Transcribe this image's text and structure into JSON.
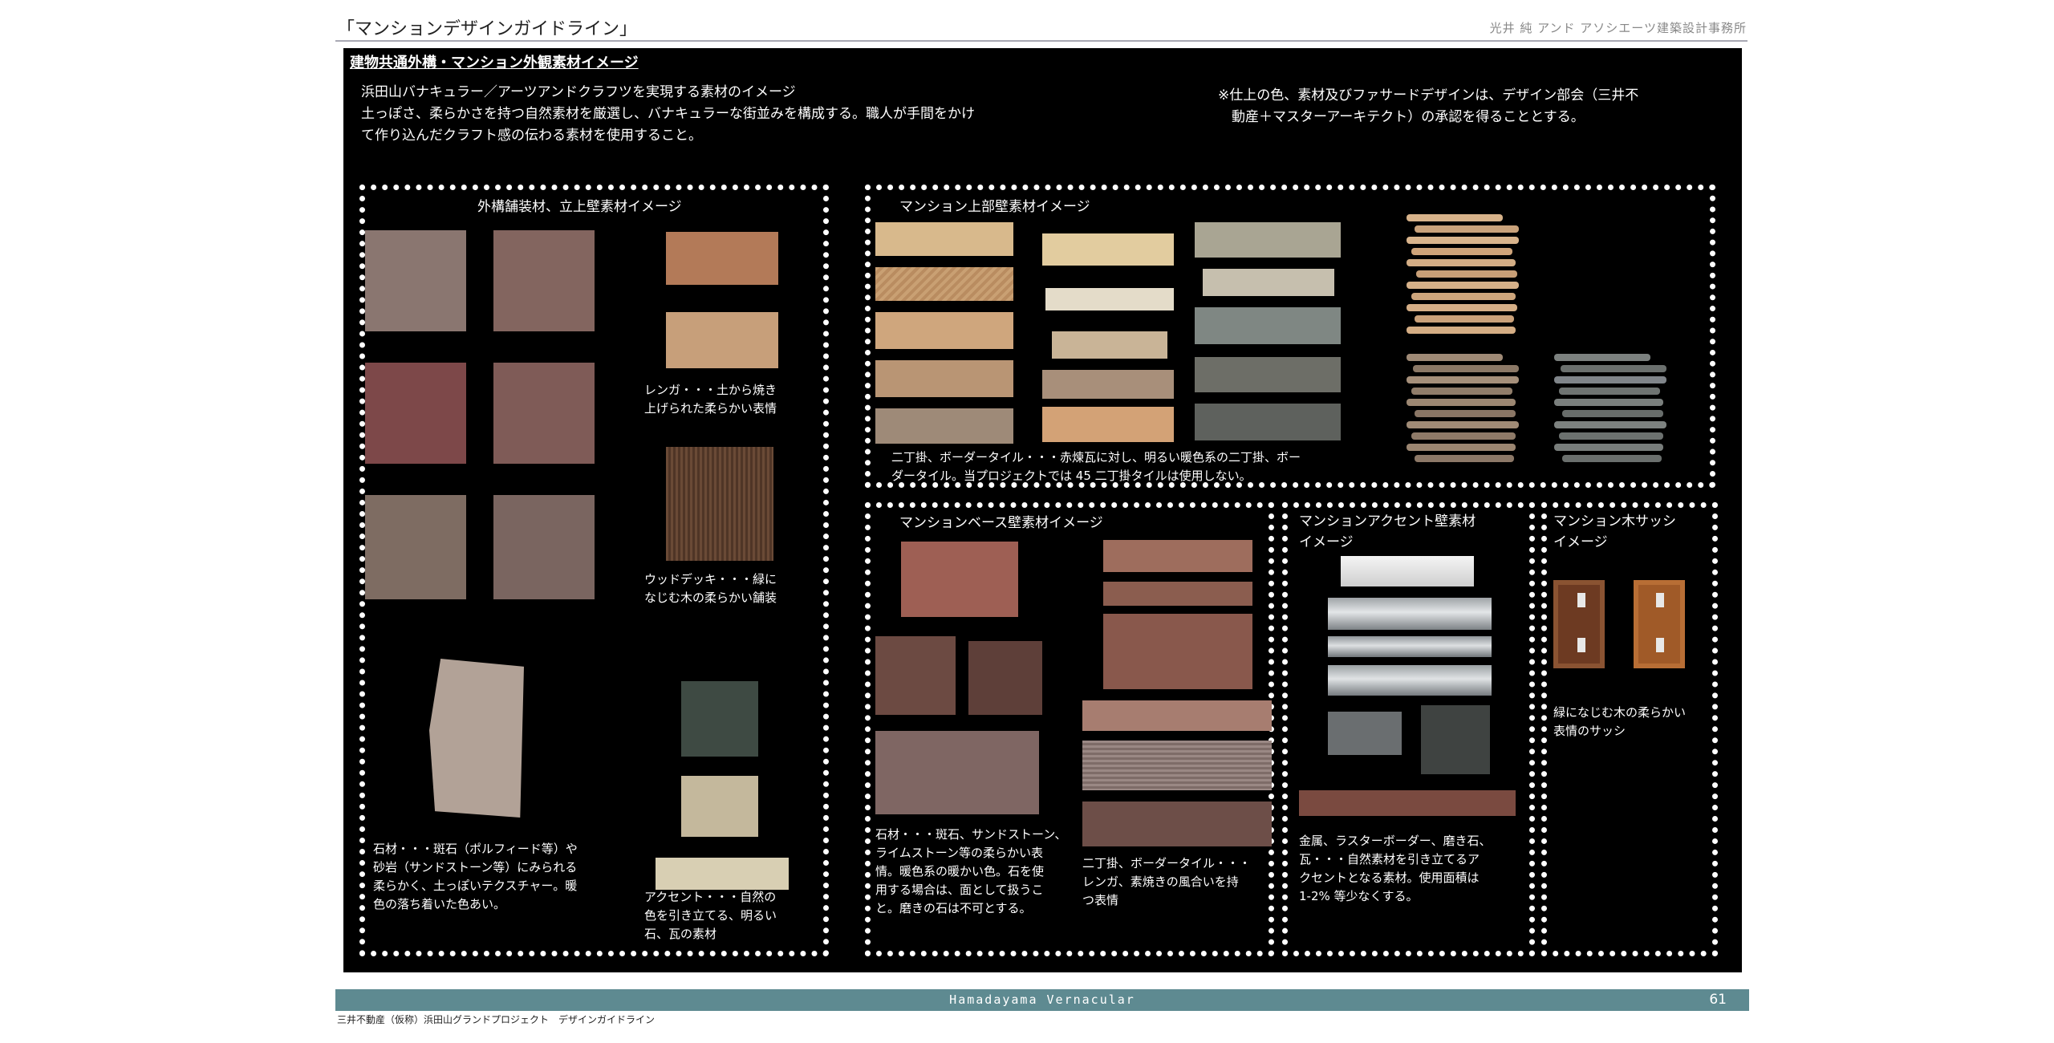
{
  "header": {
    "title": "「マンションデザインガイドライン」",
    "firm": "光井 純 アンド アソシエーツ建築設計事務所"
  },
  "section": {
    "title": "建物共通外構・マンション外観素材イメージ",
    "intro": [
      "浜田山バナキュラー／アーツアンドクラフツを実現する素材のイメージ",
      "土っぽさ、柔らかさを持つ自然素材を厳選し、バナキュラーな街並みを構成する。職人が手間をかけ",
      "て作り込んだクラフト感の伝わる素材を使用すること。"
    ],
    "note": [
      "※仕上の色、素材及びファサードデザインは、デザイン部会（三井不",
      "　動産＋マスターアーキテクト）の承認を得ることとする。"
    ]
  },
  "boxes": {
    "exterior": {
      "title": "外構舗装材、立上壁素材イメージ",
      "brick_caption": [
        "レンガ・・・土から焼き",
        "上げられた柔らかい表情"
      ],
      "deck_caption": [
        "ウッドデッキ・・・緑に",
        "なじむ木の柔らかい舗装"
      ],
      "stone_caption": [
        "石材・・・斑石（ポルフィード等）や",
        "砂岩（サンドストーン等）にみられる",
        "柔らかく、土っぽいテクスチャー。暖",
        "色の落ち着いた色あい。"
      ],
      "accent_caption": [
        "アクセント・・・自然の",
        "色を引き立てる、明るい",
        "石、瓦の素材"
      ]
    },
    "upper": {
      "title": "マンション上部壁素材イメージ",
      "caption": [
        "二丁掛、ボーダータイル・・・赤煉瓦に対し、明るい暖色系の二丁掛、ボー",
        "ダータイル。当プロジェクトでは 45 二丁掛タイルは使用しない。"
      ]
    },
    "base": {
      "title": "マンションベース壁素材イメージ",
      "stone_caption": [
        "石材・・・斑石、サンドストーン、",
        "ライムストーン等の柔らかい表",
        "情。暖色系の暖かい色。石を使",
        "用する場合は、面として扱うこ",
        "と。磨きの石は不可とする。"
      ],
      "tile_caption": [
        "二丁掛、ボーダータイル・・・",
        "レンガ、素焼きの風合いを持",
        "つ表情"
      ]
    },
    "accent": {
      "title": [
        "マンションアクセント壁素材",
        "イメージ"
      ],
      "caption": [
        "金属、ラスターボーダー、磨き石、",
        "瓦・・・自然素材を引き立てるア",
        "クセントとなる素材。使用面積は",
        "1-2% 等少なくする。"
      ]
    },
    "sash": {
      "title": [
        "マンション木サッシ",
        "イメージ"
      ],
      "caption": [
        "緑になじむ木の柔らかい",
        "表情のサッシ"
      ]
    }
  },
  "footer": {
    "center": "Hamadayama Vernacular",
    "page": "61",
    "sub": "三井不動産（仮称）浜田山グランドプロジェクト　デザインガイドライン"
  },
  "colors": {
    "panel": "#000000",
    "footer_bar": "#5e8a91",
    "header_rule": "#a9a9b4"
  }
}
